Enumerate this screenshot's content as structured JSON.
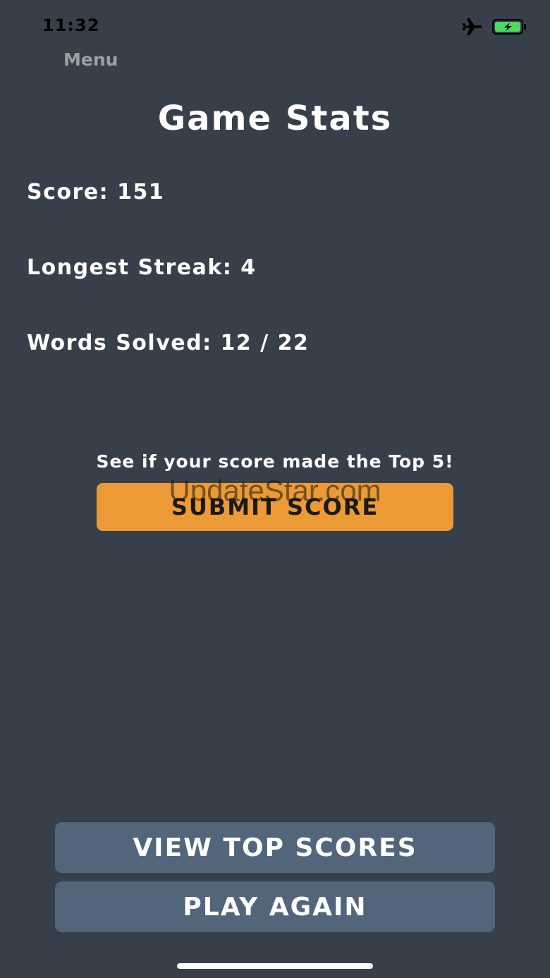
{
  "status_bar": {
    "time": "11:32",
    "icons": [
      "airplane-icon",
      "battery-charging-icon"
    ],
    "battery_color": "#4cd964"
  },
  "nav": {
    "menu_label": "Menu"
  },
  "title": "Game Stats",
  "stats": {
    "score": "Score: 151",
    "longest_streak": "Longest Streak: 4",
    "words_solved": "Words Solved: 12 / 22"
  },
  "submit": {
    "prompt": "See if your score made the Top 5!",
    "button_label": "SUBMIT SCORE",
    "button_color": "#ec9a35"
  },
  "watermark": "UpdateStar.com",
  "actions": {
    "view_top_scores": "VIEW TOP SCORES",
    "play_again": "PLAY AGAIN",
    "button_color": "#53657a"
  },
  "theme": {
    "background": "#37404a",
    "text": "#ffffff"
  }
}
